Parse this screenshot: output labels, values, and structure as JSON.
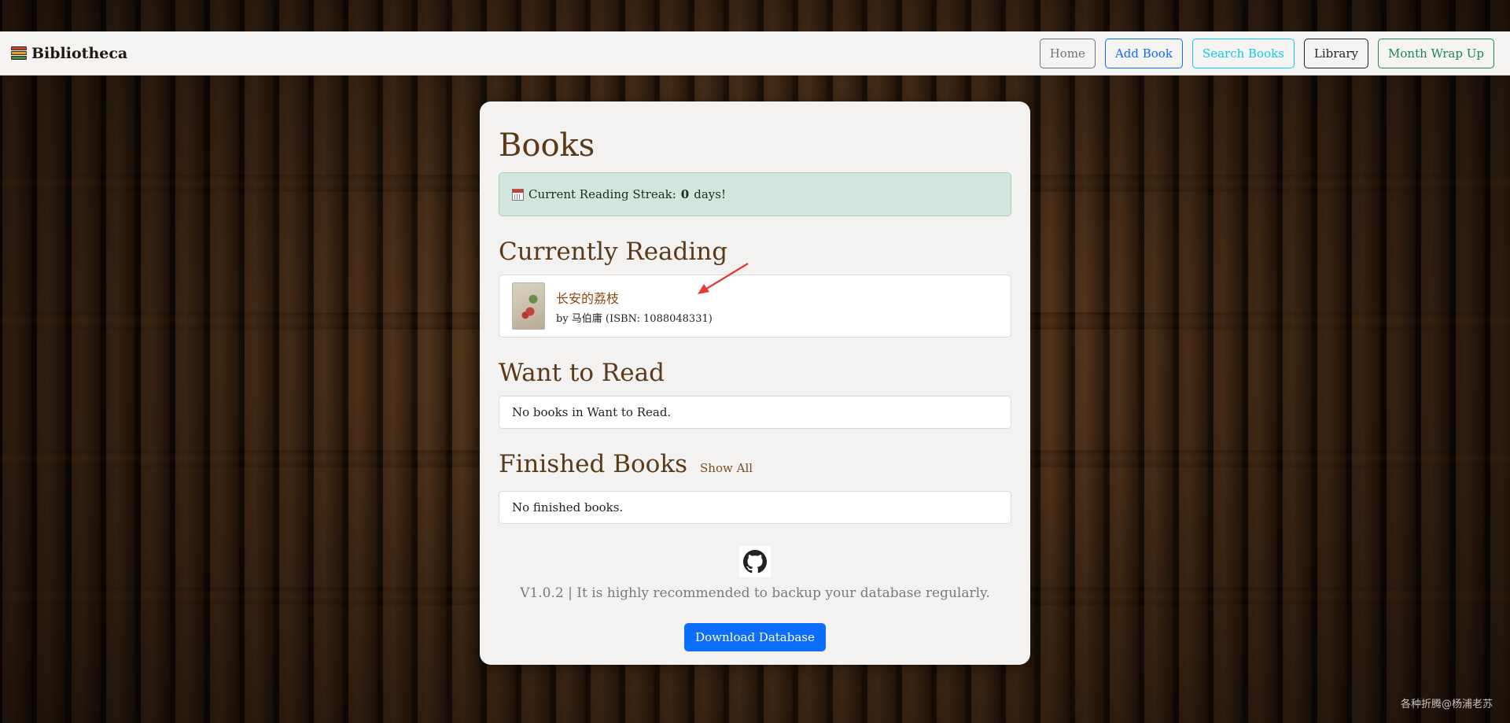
{
  "navbar": {
    "brand": "Bibliotheca",
    "buttons": [
      {
        "label": "Home",
        "color": "#6c757d"
      },
      {
        "label": "Add Book",
        "color": "#0d6efd"
      },
      {
        "label": "Search Books",
        "color": "#0dcaf0"
      },
      {
        "label": "Library",
        "color": "#212529"
      },
      {
        "label": "Month Wrap Up",
        "color": "#198754"
      }
    ]
  },
  "main": {
    "title": "Books",
    "streak": {
      "prefix": "Current Reading Streak:",
      "count": "0",
      "suffix": "days!"
    },
    "currently_reading": {
      "heading": "Currently Reading",
      "books": [
        {
          "title": "长安的荔枝",
          "meta": "by 马伯庸 (ISBN: 1088048331)"
        }
      ]
    },
    "want_to_read": {
      "heading": "Want to Read",
      "empty": "No books in Want to Read."
    },
    "finished": {
      "heading": "Finished Books",
      "show_all": "Show All",
      "empty": "No finished books."
    },
    "footer": {
      "version_text": "V1.0.2 | It is highly recommended to backup your database regularly.",
      "download_label": "Download Database"
    }
  },
  "watermark": "各种折腾@杨浦老苏",
  "colors": {
    "accent_brown": "#5b3a1a",
    "streak_bg": "#d1e7dd",
    "primary": "#0d6efd",
    "annotation_arrow": "#e53935"
  }
}
